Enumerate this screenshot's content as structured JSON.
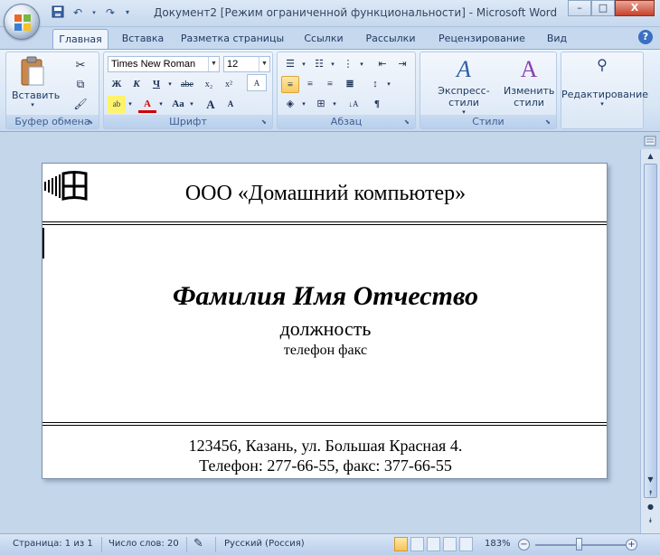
{
  "window": {
    "title": "Документ2 [Режим ограниченной функциональности] - Microsoft Word",
    "minimize": "–",
    "maximize": "□",
    "close": "X"
  },
  "tabs": [
    {
      "label": "Главная",
      "active": true
    },
    {
      "label": "Вставка"
    },
    {
      "label": "Разметка страницы"
    },
    {
      "label": "Ссылки"
    },
    {
      "label": "Рассылки"
    },
    {
      "label": "Рецензирование"
    },
    {
      "label": "Вид"
    }
  ],
  "help": "?",
  "ribbon": {
    "clipboard": {
      "label": "Буфер обмена",
      "paste_label": "Вставить"
    },
    "font": {
      "label": "Шрифт",
      "font_name": "Times New Roman",
      "font_size": "12",
      "bold": "Ж",
      "italic": "К",
      "underline": "Ч",
      "strike": "abe",
      "subscript": "x₂",
      "superscript": "x²",
      "case": "Aa",
      "grow": "A",
      "shrink": "A",
      "highlight": "ab",
      "color": "A"
    },
    "paragraph": {
      "label": "Абзац",
      "pilcrow": "¶"
    },
    "styles": {
      "label": "Стили",
      "express_label": "Экспресс-стили",
      "change_label": "Изменить стили"
    },
    "editing": {
      "label": "Редактирование"
    }
  },
  "document": {
    "company": "ООО «Домашний компьютер»",
    "fio": "Фамилия Имя Отчество",
    "position": "должность",
    "phone_fax": "телефон факс",
    "address_line1": "123456, Казань, ул. Большая Красная 4.",
    "address_line2": "Телефон: 277-66-55, факс: 377-66-55"
  },
  "statusbar": {
    "page": "Страница: 1 из 1",
    "words": "Число слов: 20",
    "language": "Русский (Россия)",
    "zoom": "183%",
    "zoom_minus": "−",
    "zoom_plus": "+"
  }
}
